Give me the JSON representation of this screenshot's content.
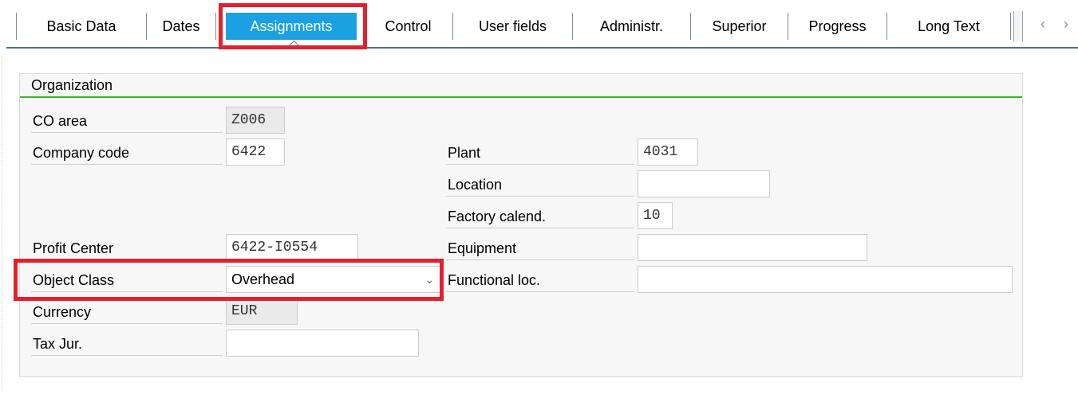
{
  "tabs": [
    {
      "label": "Basic Data",
      "active": false
    },
    {
      "label": "Dates",
      "active": false
    },
    {
      "label": "Assignments",
      "active": true
    },
    {
      "label": "Control",
      "active": false
    },
    {
      "label": "User fields",
      "active": false
    },
    {
      "label": "Administr.",
      "active": false
    },
    {
      "label": "Superior",
      "active": false
    },
    {
      "label": "Progress",
      "active": false
    },
    {
      "label": "Long Text",
      "active": false
    }
  ],
  "nav": {
    "prev": "‹",
    "next": "›"
  },
  "organization": {
    "title": "Organization",
    "co_area": {
      "label": "CO area",
      "value": "Z006"
    },
    "company_code": {
      "label": "Company code",
      "value": "6422"
    },
    "plant": {
      "label": "Plant",
      "value": "4031"
    },
    "location": {
      "label": "Location",
      "value": ""
    },
    "factory_calendar": {
      "label": "Factory calend.",
      "value": "10"
    },
    "profit_center": {
      "label": "Profit Center",
      "value": "6422-I0554"
    },
    "equipment": {
      "label": "Equipment",
      "value": ""
    },
    "object_class": {
      "label": "Object Class",
      "value": "Overhead"
    },
    "functional_loc": {
      "label": "Functional loc.",
      "value": ""
    },
    "currency": {
      "label": "Currency",
      "value": "EUR"
    },
    "tax_jur": {
      "label": "Tax Jur.",
      "value": ""
    }
  },
  "colors": {
    "active_tab": "#1ba1e2",
    "highlight": "#e3202d",
    "group_line": "#3cb02e"
  }
}
